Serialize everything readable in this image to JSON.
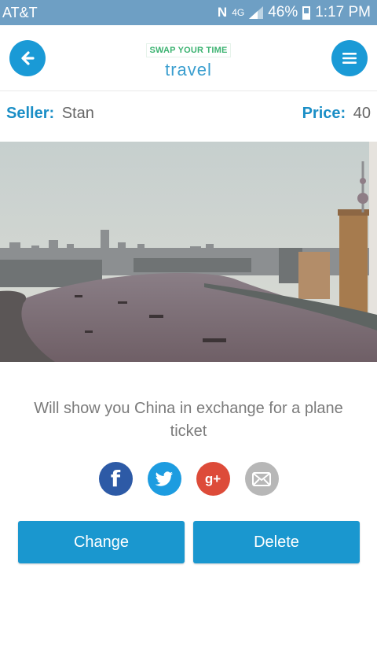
{
  "status_bar": {
    "carrier": "AT&T",
    "nfc": "N",
    "network": "4G",
    "battery": "46%",
    "time": "1:17 PM"
  },
  "header": {
    "logo_text": "SWAP YOUR TIME",
    "category": "travel",
    "back_icon": "arrow-left-icon",
    "menu_icon": "hamburger-menu-icon"
  },
  "listing": {
    "seller_label": "Seller:",
    "seller_name": "Stan",
    "price_label": "Price:",
    "price_value": "40",
    "description": "Will show you China in exchange for a plane ticket"
  },
  "share": {
    "icons": [
      "facebook-icon",
      "twitter-icon",
      "google-plus-icon",
      "email-icon"
    ],
    "facebook_glyph": "f",
    "google_glyph": "g+"
  },
  "actions": {
    "change_label": "Change",
    "delete_label": "Delete"
  },
  "colors": {
    "accent": "#1a97cf",
    "status_bar": "#6e9fc4",
    "logo_green": "#3cb371"
  }
}
